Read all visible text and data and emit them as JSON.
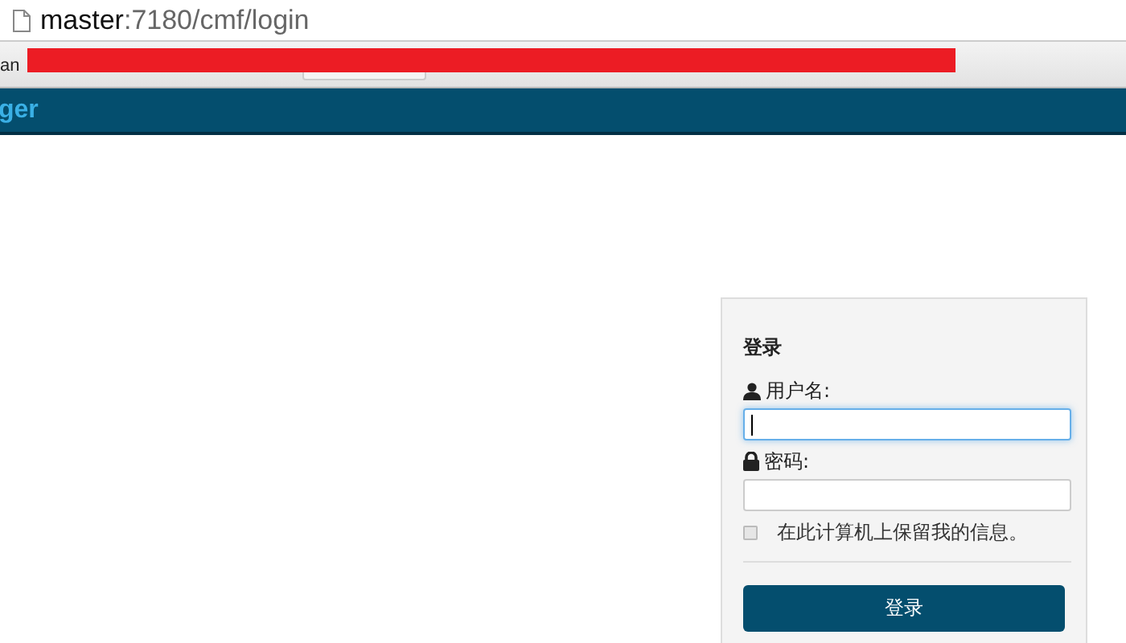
{
  "address_bar": {
    "host": "master",
    "path": ":7180/cmf/login"
  },
  "bookmarks_bar": {
    "items": [
      "an"
    ]
  },
  "navbar": {
    "brand": "ger"
  },
  "login": {
    "title": "登录",
    "username": {
      "label": "用户名:",
      "focused": true
    },
    "password": {
      "label": "密码:",
      "focused": false
    },
    "remember": {
      "label": "在此计算机上保留我的信息。",
      "checked": false
    },
    "submit": "登录"
  }
}
